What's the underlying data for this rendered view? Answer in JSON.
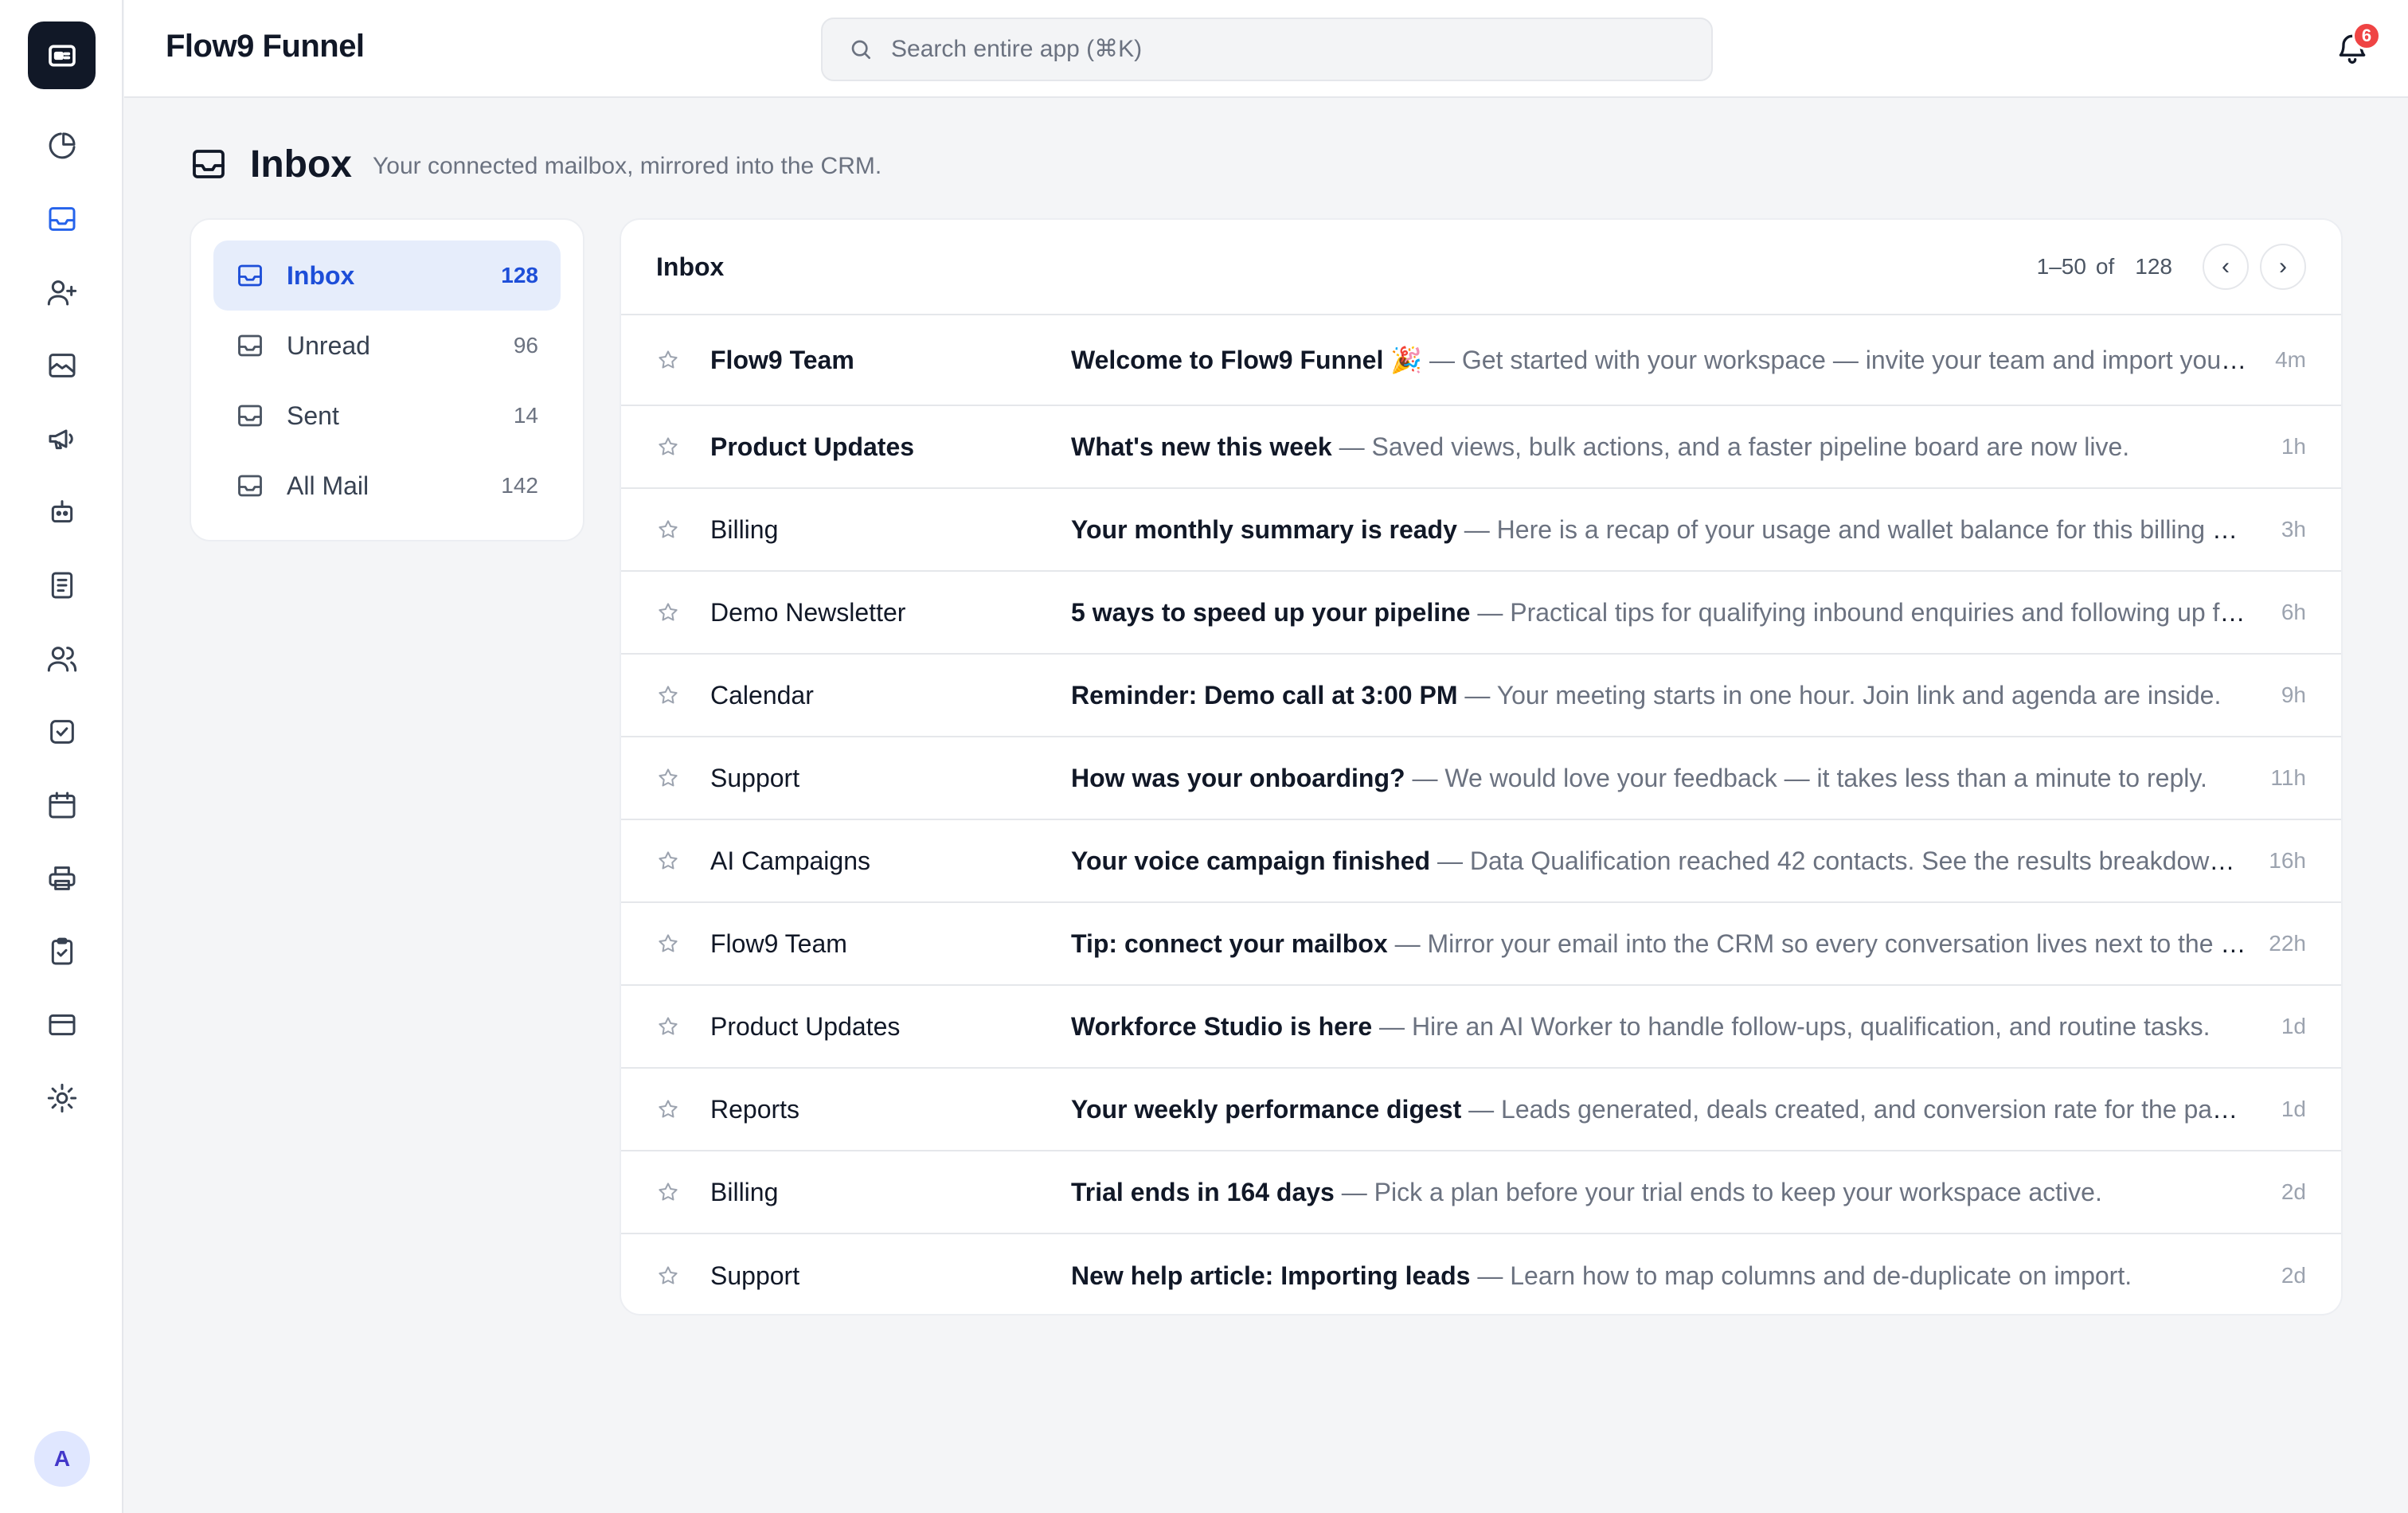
{
  "app": {
    "title": "Flow9 Funnel"
  },
  "search": {
    "placeholder": "Search entire app (⌘K)"
  },
  "notifications": {
    "count": "6"
  },
  "user": {
    "avatar_initial": "A"
  },
  "nav": {
    "items": [
      {
        "icon": "pie-chart-icon",
        "active": false
      },
      {
        "icon": "inbox-icon",
        "active": true
      },
      {
        "icon": "user-plus-icon",
        "active": false
      },
      {
        "icon": "image-icon",
        "active": false
      },
      {
        "icon": "megaphone-icon",
        "active": false
      },
      {
        "icon": "robot-icon",
        "active": false
      },
      {
        "icon": "document-icon",
        "active": false
      },
      {
        "icon": "users-icon",
        "active": false
      },
      {
        "icon": "check-square-icon",
        "active": false
      },
      {
        "icon": "calendar-icon",
        "active": false
      },
      {
        "icon": "printer-icon",
        "active": false
      },
      {
        "icon": "clipboard-check-icon",
        "active": false
      },
      {
        "icon": "credit-card-icon",
        "active": false
      },
      {
        "icon": "settings-icon",
        "active": false
      }
    ]
  },
  "page": {
    "title": "Inbox",
    "subtitle": "Your connected mailbox, mirrored into the CRM."
  },
  "folders": [
    {
      "label": "Inbox",
      "count": "128",
      "active": true
    },
    {
      "label": "Unread",
      "count": "96",
      "active": false
    },
    {
      "label": "Sent",
      "count": "14",
      "active": false
    },
    {
      "label": "All Mail",
      "count": "142",
      "active": false
    }
  ],
  "list": {
    "title": "Inbox",
    "range": "1–50",
    "of": "of",
    "total": "128",
    "prev": "‹",
    "next": "›",
    "separator": " — ",
    "messages": [
      {
        "sender": "Flow9 Team",
        "subject": "Welcome to Flow9 Funnel 🎉",
        "preview": "Get started with your workspace — invite your team and import your contacts to begin.",
        "time": "4m",
        "unread": true
      },
      {
        "sender": "Product Updates",
        "subject": "What's new this week",
        "preview": "Saved views, bulk actions, and a faster pipeline board are now live.",
        "time": "1h",
        "unread": true
      },
      {
        "sender": "Billing",
        "subject": "Your monthly summary is ready",
        "preview": "Here is a recap of your usage and wallet balance for this billing period.",
        "time": "3h",
        "unread": false
      },
      {
        "sender": "Demo Newsletter",
        "subject": "5 ways to speed up your pipeline",
        "preview": "Practical tips for qualifying inbound enquiries and following up faster.",
        "time": "6h",
        "unread": false
      },
      {
        "sender": "Calendar",
        "subject": "Reminder: Demo call at 3:00 PM",
        "preview": "Your meeting starts in one hour. Join link and agenda are inside.",
        "time": "9h",
        "unread": false
      },
      {
        "sender": "Support",
        "subject": "How was your onboarding?",
        "preview": "We would love your feedback — it takes less than a minute to reply.",
        "time": "11h",
        "unread": false
      },
      {
        "sender": "AI Campaigns",
        "subject": "Your voice campaign finished",
        "preview": "Data Qualification reached 42 contacts. See the results breakdown in your dashboard.",
        "time": "16h",
        "unread": false
      },
      {
        "sender": "Flow9 Team",
        "subject": "Tip: connect your mailbox",
        "preview": "Mirror your email into the CRM so every conversation lives next to the contact record.",
        "time": "22h",
        "unread": false
      },
      {
        "sender": "Product Updates",
        "subject": "Workforce Studio is here",
        "preview": "Hire an AI Worker to handle follow-ups, qualification, and routine tasks.",
        "time": "1d",
        "unread": false
      },
      {
        "sender": "Reports",
        "subject": "Your weekly performance digest",
        "preview": "Leads generated, deals created, and conversion rate for the past seven days.",
        "time": "1d",
        "unread": false
      },
      {
        "sender": "Billing",
        "subject": "Trial ends in 164 days",
        "preview": "Pick a plan before your trial ends to keep your workspace active.",
        "time": "2d",
        "unread": false
      },
      {
        "sender": "Support",
        "subject": "New help article: Importing leads",
        "preview": "Learn how to map columns and de-duplicate on import.",
        "time": "2d",
        "unread": false
      }
    ]
  }
}
